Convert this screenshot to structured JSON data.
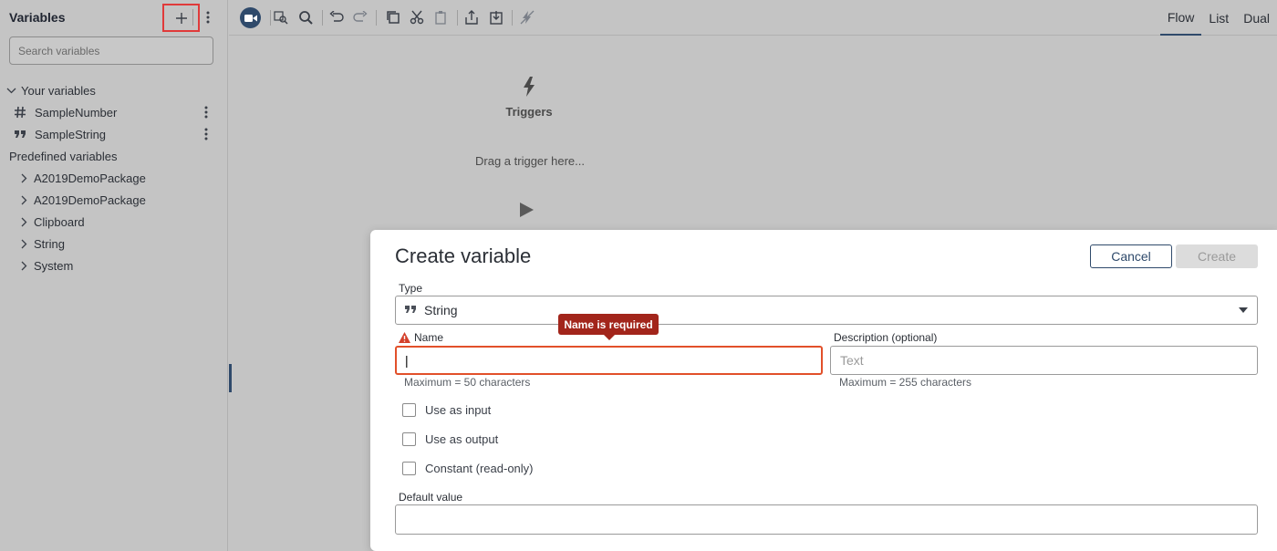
{
  "sidebar": {
    "title": "Variables",
    "search_placeholder": "Search variables",
    "your_variables_label": "Your variables",
    "user_variables": [
      {
        "name": "SampleNumber",
        "type_icon": "hash-icon"
      },
      {
        "name": "SampleString",
        "type_icon": "quote-icon"
      }
    ],
    "predefined_label": "Predefined variables",
    "predefined_groups": [
      "A2019DemoPackage",
      "A2019DemoPackage",
      "Clipboard",
      "String",
      "System"
    ]
  },
  "toolbar": {
    "icons": [
      "record-icon",
      "find-icon",
      "search-icon",
      "undo-icon",
      "redo-icon",
      "copy-icon",
      "cut-icon",
      "paste-icon",
      "export-icon",
      "import-icon",
      "disable-icon"
    ],
    "view_tabs": [
      "Flow",
      "List",
      "Dual"
    ],
    "active_view": "Flow"
  },
  "canvas": {
    "triggers_label": "Triggers",
    "drag_hint": "Drag a trigger here..."
  },
  "dialog": {
    "title": "Create variable",
    "cancel_label": "Cancel",
    "create_label": "Create",
    "type_label": "Type",
    "type_value": "String",
    "name_label": "Name",
    "name_error": "Name is required",
    "name_value": "|",
    "name_hint": "Maximum = 50 characters",
    "description_label": "Description (optional)",
    "description_placeholder": "Text",
    "description_hint": "Maximum = 255 characters",
    "checkboxes": [
      {
        "label": "Use as input",
        "checked": false
      },
      {
        "label": "Use as output",
        "checked": false
      },
      {
        "label": "Constant (read-only)",
        "checked": false
      }
    ],
    "default_value_label": "Default value"
  },
  "colors": {
    "accent": "#2f4a6b",
    "error": "#a2251b",
    "error_border": "#e2502a",
    "highlight_box": "#e03a3a"
  }
}
